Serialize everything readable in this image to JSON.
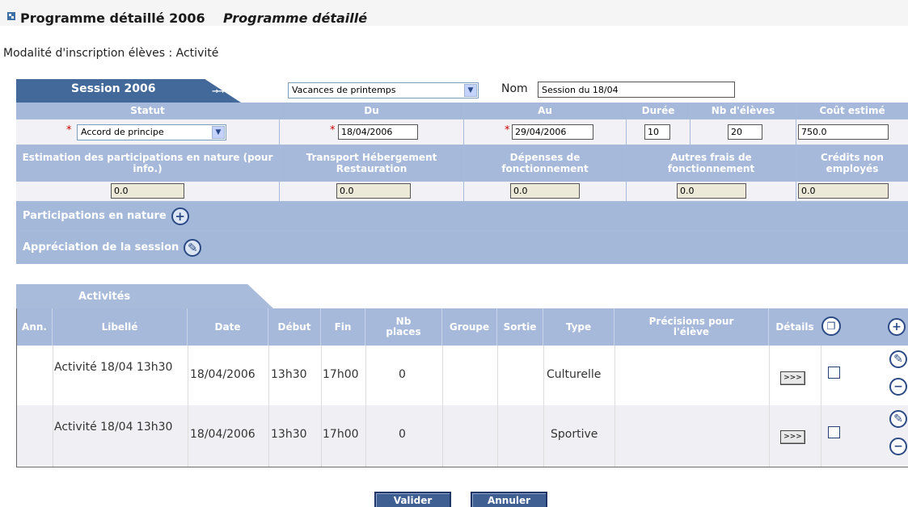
{
  "header": {
    "title": "Programme détaillé 2006",
    "subtitle": "Programme détaillé",
    "modalite": "Modalité d'inscription élèves : Activité"
  },
  "session": {
    "tab_label": "Session 2006",
    "arrows": "→→",
    "periode_value": "Vacances de printemps",
    "nom_label": "Nom",
    "nom_value": "Session du 18/04",
    "headers": {
      "statut": "Statut",
      "du": "Du",
      "au": "Au",
      "duree": "Durée",
      "nb_eleves": "Nb d'élèves",
      "cout": "Coût estimé"
    },
    "values": {
      "statut": "Accord de principe",
      "du": "18/04/2006",
      "au": "29/04/2006",
      "duree": "10",
      "nb_eleves": "20",
      "cout": "750.0"
    },
    "headers2": {
      "estimation": "Estimation des participations en nature (pour info.)",
      "transport": "Transport Hébergement Restauration",
      "depenses": "Dépenses de fonctionnement",
      "autres": "Autres frais de fonctionnement",
      "credits": "Crédits non employés"
    },
    "values2": {
      "estimation": "0.0",
      "transport": "0.0",
      "depenses": "0.0",
      "autres": "0.0",
      "credits": "0.0"
    },
    "participations_label": "Participations en nature",
    "appreciation_label": "Appréciation de la session"
  },
  "activites": {
    "tab_label": "Activités",
    "columns": {
      "ann": "Ann.",
      "libelle": "Libellé",
      "date": "Date",
      "debut": "Début",
      "fin": "Fin",
      "nb_places": "Nb places",
      "groupe": "Groupe",
      "sortie": "Sortie",
      "type": "Type",
      "precisions": "Précisions pour l'élève",
      "details": "Détails"
    },
    "rows": [
      {
        "libelle": "Activité 18/04 13h30",
        "date": "18/04/2006",
        "debut": "13h30",
        "fin": "17h00",
        "nb_places": "0",
        "type": "Culturelle",
        "details_btn": ">>>"
      },
      {
        "libelle": "Activité 18/04 13h30",
        "date": "18/04/2006",
        "debut": "13h30",
        "fin": "17h00",
        "nb_places": "0",
        "type": "Sportive",
        "details_btn": ">>>"
      }
    ]
  },
  "buttons": {
    "valider": "Valider",
    "annuler": "Annuler"
  }
}
